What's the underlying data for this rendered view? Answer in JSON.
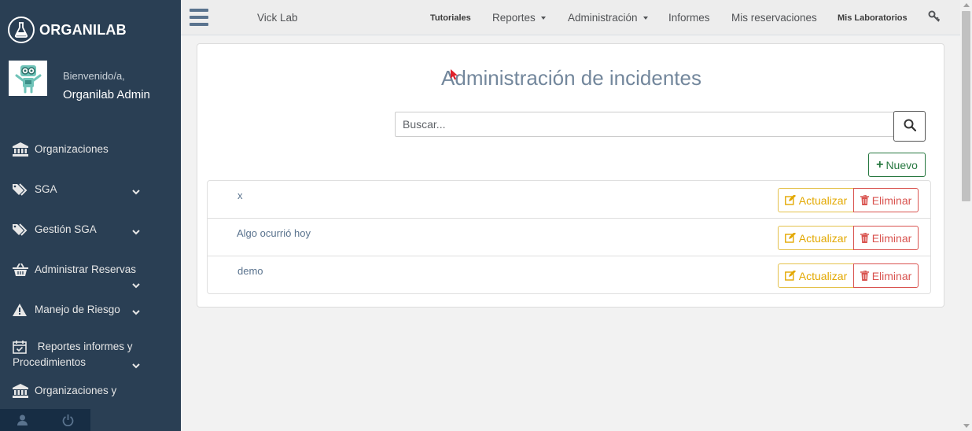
{
  "sidebar": {
    "brand": "ORGANILAB",
    "welcome": "Bienvenido/a,",
    "username": "Organilab Admin",
    "items": [
      {
        "label": "Organizaciones",
        "icon": "bank-icon"
      },
      {
        "label": "SGA",
        "icon": "tags-icon"
      },
      {
        "label": "Gestión SGA",
        "icon": "tags-icon"
      },
      {
        "label": "Administrar Reservas",
        "icon": "basket-icon"
      },
      {
        "label": "Manejo de Riesgo",
        "icon": "warning-icon"
      },
      {
        "label": "Reportes informes y Procedimientos",
        "icon": "calendar-check-icon"
      },
      {
        "label": "Organizaciones y",
        "icon": "bank-icon"
      }
    ]
  },
  "topnav": {
    "lab": "Vick Lab",
    "tutorials": "Tutoriales",
    "reports": "Reportes",
    "administration": "Administración",
    "informs": "Informes",
    "reservations": "Mis reservaciones",
    "labs": "Mis Laboratorios"
  },
  "main": {
    "title": "Administración de incidentes",
    "search_placeholder": "Buscar...",
    "new_label": "Nuevo",
    "update_label": "Actualizar",
    "delete_label": "Eliminar",
    "incidents": [
      {
        "name": "x"
      },
      {
        "name": "Algo ocurrió hoy"
      },
      {
        "name": "demo"
      }
    ]
  },
  "colors": {
    "sidebar": "#2a3f54",
    "accent_green": "#26773f",
    "warning": "#e3a800",
    "danger": "#d9534f"
  }
}
